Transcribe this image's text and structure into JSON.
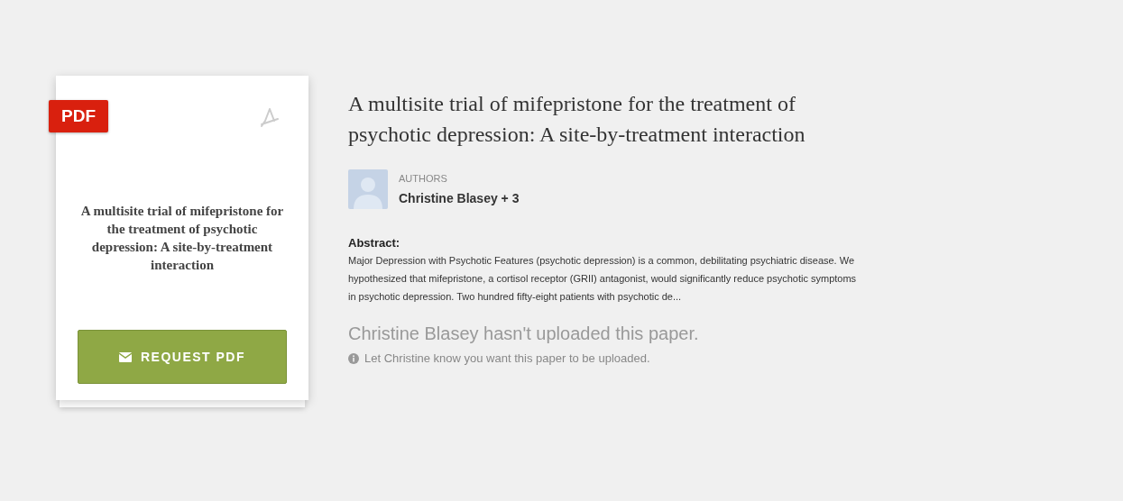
{
  "card": {
    "badge": "PDF",
    "title": "A multisite trial of mifepristone for the treatment of psychotic depression: A site-by-treatment interaction",
    "button": "REQUEST PDF"
  },
  "paper": {
    "title": "A multisite trial of mifepristone for the treatment of psychotic depression: A site-by-treatment interaction",
    "authors_label": "AUTHORS",
    "authors": "Christine Blasey + 3",
    "abstract_label": "Abstract:",
    "abstract": "Major Depression with Psychotic Features (psychotic depression) is a common, debilitating psychiatric disease. We hypothesized that mifepristone, a cortisol receptor (GRII) antagonist, would significantly reduce psychotic symptoms in psychotic depression. Two hundred fifty-eight patients with psychotic de...",
    "notice": "Christine Blasey hasn't uploaded this paper.",
    "hint": "Let Christine know you want this paper to be uploaded."
  }
}
